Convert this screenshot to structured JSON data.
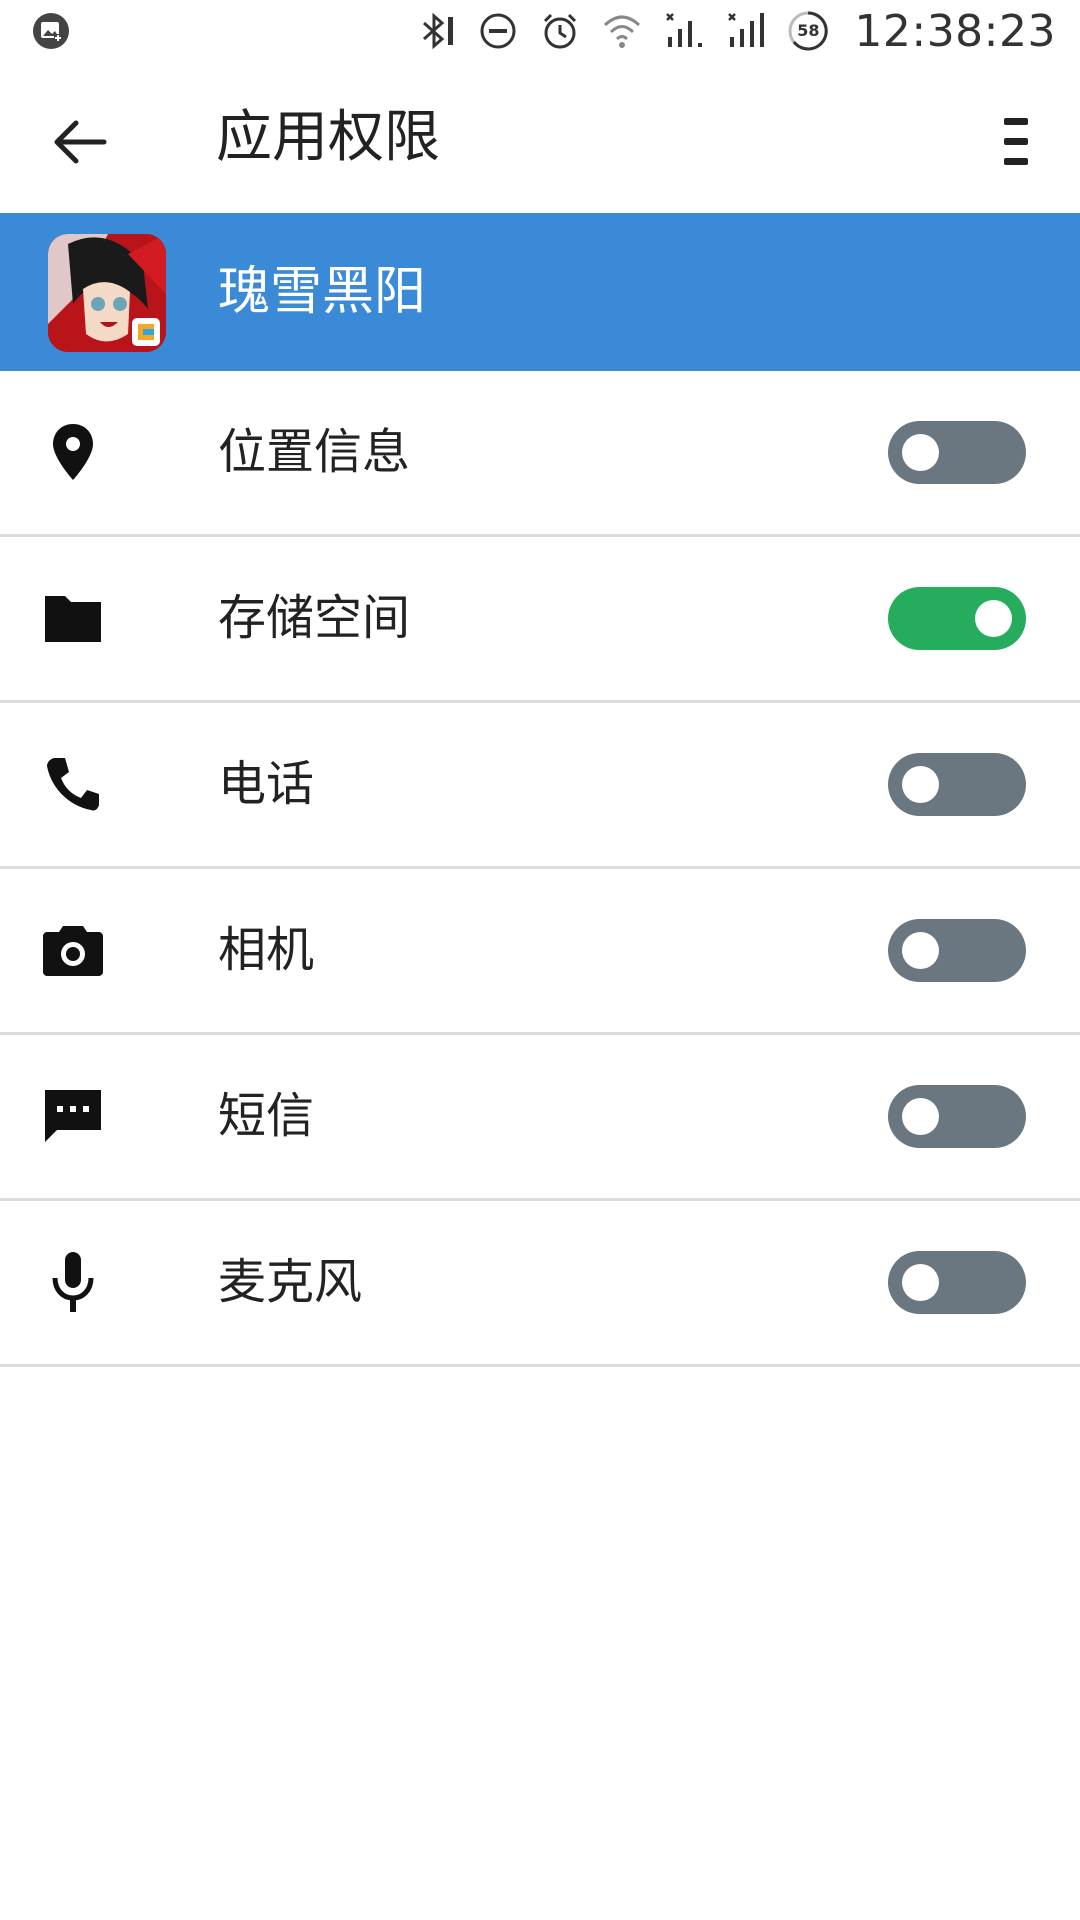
{
  "status_bar": {
    "time": "12:38:23",
    "battery_level": "58",
    "icons": [
      "gallery-notification-icon",
      "bluetooth-icon",
      "do-not-disturb-icon",
      "alarm-icon",
      "wifi-icon",
      "signal-sim1-icon",
      "signal-sim2-icon",
      "battery-icon"
    ]
  },
  "app_bar": {
    "title": "应用权限",
    "back_icon": "arrow-back-icon",
    "menu_icon": "overflow-menu-icon"
  },
  "app_header": {
    "name": "瑰雪黑阳",
    "background_color": "#3a8ad8"
  },
  "permissions": [
    {
      "label": "位置信息",
      "icon": "location-pin-icon",
      "enabled": false
    },
    {
      "label": "存储空间",
      "icon": "folder-icon",
      "enabled": true
    },
    {
      "label": "电话",
      "icon": "phone-icon",
      "enabled": false
    },
    {
      "label": "相机",
      "icon": "camera-icon",
      "enabled": false
    },
    {
      "label": "短信",
      "icon": "sms-icon",
      "enabled": false
    },
    {
      "label": "麦克风",
      "icon": "microphone-icon",
      "enabled": false
    }
  ],
  "colors": {
    "toggle_on": "#25ad5d",
    "toggle_off": "#6b7780",
    "divider": "#dcdcdc"
  }
}
